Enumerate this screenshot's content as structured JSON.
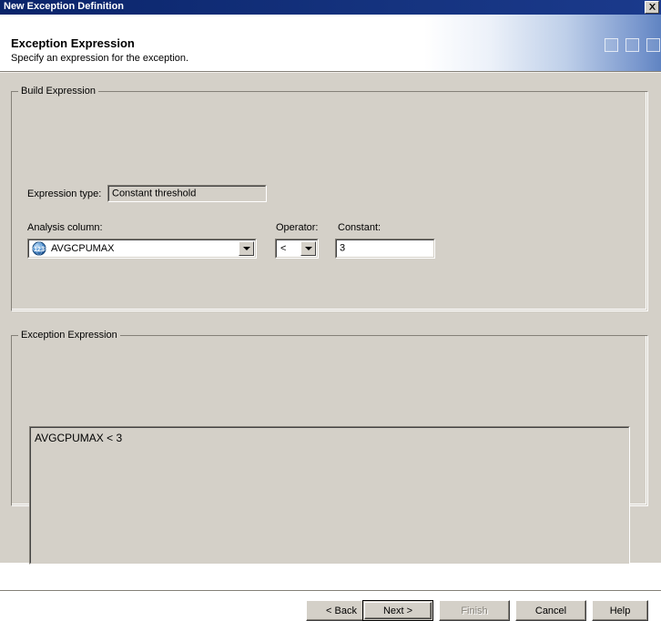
{
  "window": {
    "title": "New Exception Definition",
    "close_icon": "close-x-icon"
  },
  "header": {
    "title": "Exception Expression",
    "subtitle": "Specify an expression for the exception."
  },
  "build_expression": {
    "legend": "Build Expression",
    "expression_type": {
      "label": "Expression type:",
      "value": "Constant threshold"
    },
    "analysis_column": {
      "label": "Analysis column:",
      "value": "AVGCPUMAX",
      "icon": "numeric-column-icon",
      "icon_text": "123",
      "dropdown_icon": "chevron-down-icon"
    },
    "operator": {
      "label": "Operator:",
      "value": "<",
      "dropdown_icon": "chevron-down-icon"
    },
    "constant": {
      "label": "Constant:",
      "value": "3",
      "placeholder": ""
    }
  },
  "exception_expression": {
    "legend": "Exception Expression",
    "value": "AVGCPUMAX < 3"
  },
  "buttons": {
    "back": "< Back",
    "next": "Next >",
    "finish": "Finish",
    "cancel": "Cancel",
    "help": "Help"
  },
  "colors": {
    "titlebar": "#0a246a",
    "dialog_face": "#d4d0c8",
    "header_bg": "#ffffff",
    "accent_blue": "#6084c2",
    "disabled_text": "#848078"
  }
}
